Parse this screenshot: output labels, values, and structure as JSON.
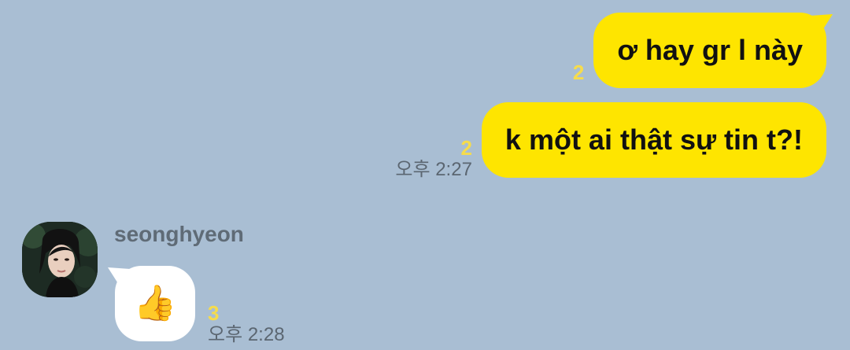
{
  "messages_out": [
    {
      "text": "ơ hay gr l này",
      "unread": "2"
    },
    {
      "text": "k một ai thật sự tin t?!",
      "unread": "2",
      "time": "오후 2:27"
    }
  ],
  "incoming": {
    "sender": "seonghyeon",
    "emoji": "👍",
    "unread": "3",
    "time": "오후 2:28"
  },
  "colors": {
    "background": "#a9bed3",
    "bubble_out": "#fee500",
    "bubble_in": "#ffffff",
    "unread_count": "#f6dc4c"
  },
  "icons": {
    "avatar": "profile-photo",
    "reaction": "thumbs-up-icon"
  }
}
